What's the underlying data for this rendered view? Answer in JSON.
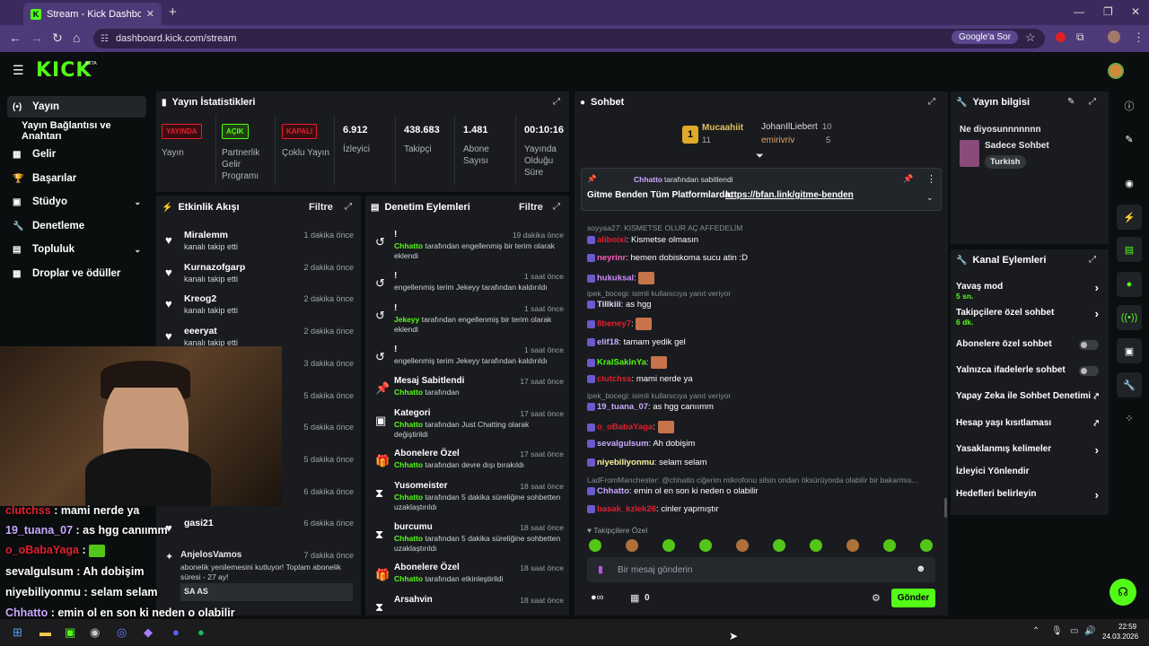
{
  "browser": {
    "tab_title": "Stream - Kick Dashboard",
    "url": "dashboard.kick.com/stream",
    "google_pill": "Google'a Sor"
  },
  "brand": {
    "logo": "KICK",
    "beta": "BETA",
    "accent": "#53fc18"
  },
  "sidebar": [
    {
      "label": "Yayın",
      "icon": "(•)",
      "active": true
    },
    {
      "label": "Yayın Bağlantısı ve Anahtarı",
      "icon": ""
    },
    {
      "label": "Gelir",
      "icon": "▦"
    },
    {
      "label": "Başarılar",
      "icon": "🏆"
    },
    {
      "label": "Stüdyo",
      "icon": "▣",
      "chevron": true
    },
    {
      "label": "Denetleme",
      "icon": "🔧"
    },
    {
      "label": "Topluluk",
      "icon": "▤",
      "chevron": true
    },
    {
      "label": "Droplar ve ödüller",
      "icon": "▦"
    }
  ],
  "stats": {
    "title": "Yayın İstatistikleri",
    "badges": [
      {
        "badge": "YAYINDA",
        "label": "Yayın",
        "color": "#e0202e"
      },
      {
        "badge": "AÇIK",
        "label": "Partnerlik Gelir Programı",
        "color": "#53fc18"
      },
      {
        "badge": "KAPALI",
        "label": "Çoklu Yayın",
        "color": "#e0202e"
      }
    ],
    "numbers": [
      {
        "value": "6.912",
        "label": "İzleyici"
      },
      {
        "value": "438.683",
        "label": "Takipçi"
      },
      {
        "value": "1.481",
        "label": "Abone Sayısı"
      },
      {
        "value": "00:10:16",
        "label": "Yayında Olduğu Süre"
      }
    ]
  },
  "activity": {
    "title": "Etkinlik Akışı",
    "filter": "Filtre",
    "items": [
      {
        "name": "Miralemm",
        "sub": "kanalı takip etti",
        "time": "1 dakika önce"
      },
      {
        "name": "Kurnazofgarp",
        "sub": "kanalı takip etti",
        "time": "2 dakika önce"
      },
      {
        "name": "Kreog2",
        "sub": "kanalı takip etti",
        "time": "2 dakika önce"
      },
      {
        "name": "eeeryat",
        "sub": "kanalı takip etti",
        "time": "2 dakika önce"
      },
      {
        "name": "",
        "sub": "",
        "time": "3 dakika önce"
      },
      {
        "name": "",
        "sub": "",
        "time": "5 dakika önce"
      },
      {
        "name": "",
        "sub": "",
        "time": "5 dakika önce"
      },
      {
        "name": "",
        "sub": "",
        "time": "5 dakika önce"
      },
      {
        "name": "",
        "sub": "",
        "time": "6 dakika önce"
      },
      {
        "name": "gasi21",
        "sub": "",
        "time": "6 dakika önce"
      }
    ],
    "sub_event": {
      "name": "AnjelosVamos",
      "time": "7 dakika önce",
      "text": "abonelik yenilemesini kutluyor! Toplam abonelik süresi - 27 ay!",
      "msg": "SA AS"
    }
  },
  "moderation": {
    "title": "Denetim Eylemleri",
    "filter": "Filtre",
    "items": [
      {
        "icon": "↺",
        "name": "!",
        "time": "19 dakika önce",
        "who": "Chhatto",
        "text": " tarafından engellenmiş bir terim olarak eklendi"
      },
      {
        "icon": "↺",
        "name": "!",
        "time": "1 saat önce",
        "who": "",
        "text": "engellenmiş terim Jekeyy tarafından kaldırıldı"
      },
      {
        "icon": "↺",
        "name": "!",
        "time": "1 saat önce",
        "who": "Jekeyy",
        "text": " tarafından engellenmiş bir terim olarak eklendi"
      },
      {
        "icon": "↺",
        "name": "!",
        "time": "1 saat önce",
        "who": "",
        "text": "engellenmiş terim Jekeyy tarafından kaldırıldı"
      },
      {
        "icon": "📌",
        "name": "Mesaj Sabitlendi",
        "time": "17 saat önce",
        "who": "Chhatto",
        "text": " tarafından"
      },
      {
        "icon": "▣",
        "name": "Kategori",
        "time": "17 saat önce",
        "who": "Chhatto",
        "text": " tarafından Just Chatting olarak değiştirildi"
      },
      {
        "icon": "🎁",
        "name": "Abonelere Özel",
        "time": "17 saat önce",
        "who": "Chhatto",
        "text": " tarafından devre dışı bırakıldı"
      },
      {
        "icon": "⧗",
        "name": "Yusomeister",
        "time": "18 saat önce",
        "who": "Chhatto",
        "text": " tarafından 5 dakika süreliğine sohbetten uzaklaştırıldı"
      },
      {
        "icon": "⧗",
        "name": "burcumu",
        "time": "18 saat önce",
        "who": "Chhatto",
        "text": " tarafından 5 dakika süreliğine sohbetten uzaklaştırıldı"
      },
      {
        "icon": "🎁",
        "name": "Abonelere Özel",
        "time": "18 saat önce",
        "who": "Chhatto",
        "text": " tarafından etkinleştirildi"
      },
      {
        "icon": "⧗",
        "name": "Arsahvin",
        "time": "18 saat önce",
        "who": "",
        "text": ""
      }
    ]
  },
  "chat": {
    "title": "Sohbet",
    "leaders": [
      {
        "name": "Mucaahiit",
        "value": "11",
        "rank": "1"
      },
      {
        "name": "JohanIlLiebert",
        "value": "10"
      },
      {
        "name": "emirivriv",
        "value": "5"
      }
    ],
    "pinned": {
      "by": "Chhatto",
      "suffix": "tarafından sabitlendi",
      "text": "Gitme Benden Tüm Platformlarda: ",
      "link": "https://bfan.link/gitme-benden"
    },
    "messages": [
      {
        "reply": "soyyaa27: KISMETSE OLUR AÇ AFFEDELİM",
        "user": "",
        "color": "#e0202e",
        "text": ""
      },
      {
        "user": "aliboixi",
        "color": "#e0202e",
        "text": "Kismetse olmasın"
      },
      {
        "user": "neyrinr",
        "color": "#ff5bbd",
        "text": "hemen dobiskoma sucu atin :D"
      },
      {
        "user": "hukuksal",
        "color": "#d38cff",
        "text": ""
      },
      {
        "reply": "ipek_bocegi: isimli kullanıcıya yanıt veriyor",
        "user": "Tillkiii",
        "color": "#e8d9ff",
        "text": "as hgg"
      },
      {
        "user": "8beney7",
        "color": "#e0202e",
        "text": ""
      },
      {
        "user": "elif18",
        "color": "#c9a9ff",
        "text": "tamam yedik gel"
      },
      {
        "user": "KralSakinYa",
        "color": "#53fc18",
        "text": ""
      },
      {
        "user": "clutchss",
        "color": "#e0202e",
        "text": "mami nerde ya"
      },
      {
        "reply": "ipek_bocegi: isimli kullanıcıya yanıt veriyor",
        "user": "19_tuana_07",
        "color": "#c9a9ff",
        "text": "as hgg canıımm"
      },
      {
        "user": "o_oBabaYaga",
        "color": "#e0202e",
        "text": ""
      },
      {
        "user": "sevalgulsum",
        "color": "#c9a9ff",
        "text": "Ah dobişim"
      },
      {
        "user": "niyebiliyonmu",
        "color": "#fff3a1",
        "text": "selam selam"
      },
      {
        "reply": "LadFromManchester: @chhatto ciğerim mikrofonu silsin ondan öksürüyorda olabilir bir bakarmıs...",
        "user": "Chhatto",
        "color": "#c9a9ff",
        "text": "emin ol en son ki neden o olabilir"
      },
      {
        "user": "basak_kzlek26",
        "color": "#e0202e",
        "text": "cinler yapmıştır"
      }
    ],
    "followers_only": "Takipçilere Özel",
    "input_placeholder": "Bir mesaj gönderin",
    "counter": "0",
    "send": "Gönder"
  },
  "stream_info": {
    "title": "Yayın bilgisi",
    "stream_title": "Ne diyosunnnnnnn",
    "category": "Sadece Sohbet",
    "tag": "Turkish"
  },
  "channel_actions": {
    "title": "Kanal Eylemleri",
    "items": [
      {
        "label": "Yavaş mod",
        "sub": "5 sn.",
        "kind": "arrow"
      },
      {
        "label": "Takipçilere özel sohbet",
        "sub": "6 dk.",
        "kind": "arrow"
      },
      {
        "label": "Abonelere özel sohbet",
        "sub": "",
        "kind": "toggle"
      },
      {
        "label": "Yalnızca ifadelerle sohbet",
        "sub": "",
        "kind": "toggle"
      },
      {
        "label": "Yapay Zeka ile Sohbet Denetimi",
        "sub": "",
        "kind": "ext"
      },
      {
        "label": "Hesap yaşı kısıtlaması",
        "sub": "",
        "kind": "ext"
      },
      {
        "label": "Yasaklanmış kelimeler",
        "sub": "",
        "kind": "arrow"
      },
      {
        "label": "İzleyici Yönlendir",
        "sub": "",
        "kind": "none"
      },
      {
        "label": "Hedefleri belirleyin",
        "sub": "",
        "kind": "arrow"
      }
    ]
  },
  "overlay_chat": [
    {
      "user": "clutchss",
      "color": "#e0202e",
      "text": "mami nerde ya"
    },
    {
      "user": "19_tuana_07",
      "color": "#c9a9ff",
      "text": "as hgg canıımm"
    },
    {
      "user": "o_oBabaYaga",
      "color": "#e0202e",
      "text": ""
    },
    {
      "user": "sevalgulsum",
      "color": "#fff",
      "text": "Ah dobişim"
    },
    {
      "user": "niyebiliyonmu",
      "color": "#fff",
      "text": "selam selam"
    },
    {
      "user": "Chhatto",
      "color": "#c9a9ff",
      "text": "emin ol en son ki neden o olabilir"
    },
    {
      "user": "basak_kzlek26",
      "color": "#e0202e",
      "text": "cinler yapmıştır"
    }
  ],
  "clock": {
    "time": "22:59",
    "date": "24.03.2026"
  }
}
